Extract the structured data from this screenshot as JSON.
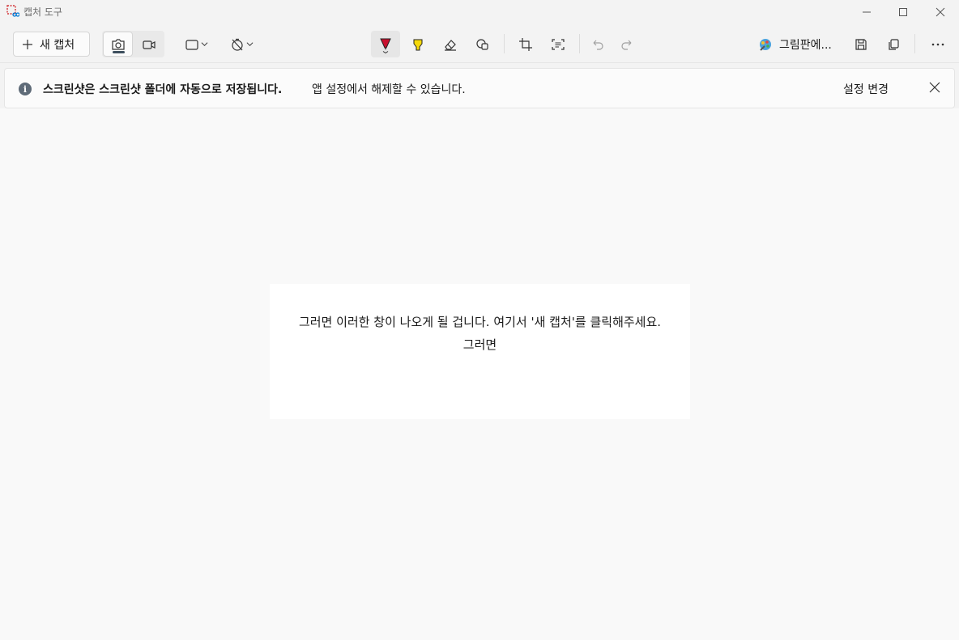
{
  "window": {
    "title": "캡처 도구"
  },
  "toolbar": {
    "new_capture_label": "새 캡처",
    "paint_label": "그림판에...",
    "icons": {
      "new": "plus-icon",
      "screenshot": "camera-icon",
      "recording": "video-icon",
      "shape": "rectangle-snip-icon",
      "delay": "timer-off-icon",
      "pen": "ballpoint-pen-icon",
      "highlighter": "highlighter-icon",
      "eraser": "eraser-icon",
      "shapes": "shapes-icon",
      "crop": "crop-icon",
      "text_actions": "text-actions-icon",
      "undo": "undo-icon",
      "redo": "redo-icon",
      "paint": "paint-icon",
      "save": "save-icon",
      "copy": "copy-icon",
      "more": "more-icon"
    }
  },
  "notice": {
    "bold_text": "스크린샷은 스크린샷 폴더에 자동으로 저장됩니다.",
    "text": "앱 설정에서 해제할 수 있습니다.",
    "link_label": "설정 변경"
  },
  "capture": {
    "line1": "그러면 이러한 창이 나오게 될 겁니다. 여기서 '새 캡처'를 클릭해주세요.",
    "line2": "그러면"
  },
  "colors": {
    "pen": "#c8102e",
    "highlighter": "#f5d90a",
    "info_icon": "#5f6b78"
  }
}
